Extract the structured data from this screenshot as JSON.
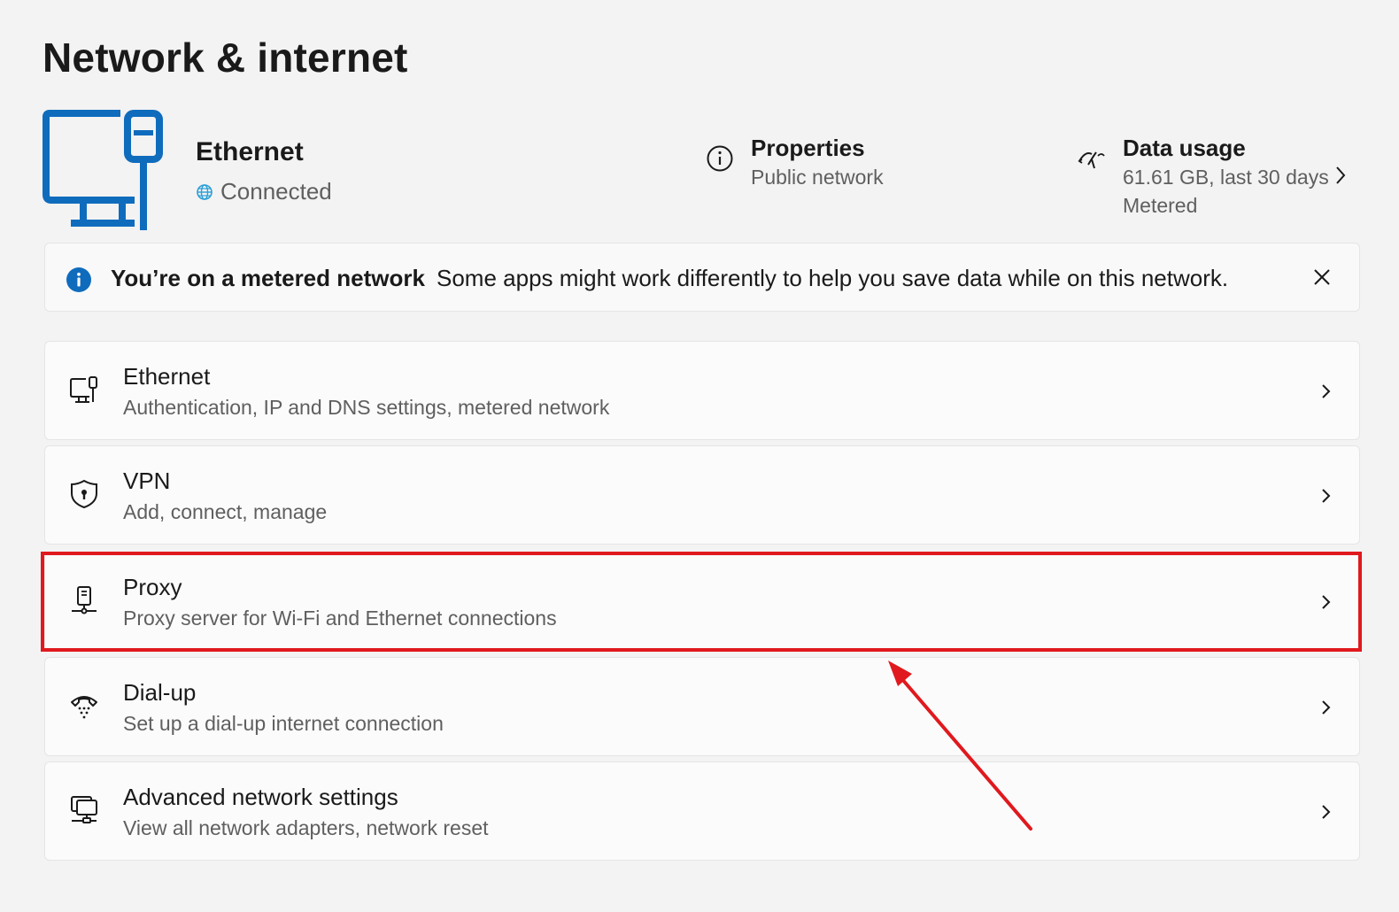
{
  "page": {
    "title": "Network & internet"
  },
  "connection": {
    "name": "Ethernet",
    "status": "Connected",
    "properties": {
      "title": "Properties",
      "subtitle": "Public network"
    },
    "data_usage": {
      "title": "Data usage",
      "line1": "61.61 GB, last 30 days",
      "line2": "Metered"
    }
  },
  "infobar": {
    "title": "You’re on a metered network",
    "message": "Some apps might work differently to help you save data while on this network."
  },
  "cards": [
    {
      "title": "Ethernet",
      "subtitle": "Authentication, IP and DNS settings, metered network",
      "icon": "ethernet-icon"
    },
    {
      "title": "VPN",
      "subtitle": "Add, connect, manage",
      "icon": "shield-icon"
    },
    {
      "title": "Proxy",
      "subtitle": "Proxy server for Wi-Fi and Ethernet connections",
      "icon": "proxy-icon"
    },
    {
      "title": "Dial-up",
      "subtitle": "Set up a dial-up internet connection",
      "icon": "dialup-icon"
    },
    {
      "title": "Advanced network settings",
      "subtitle": "View all network adapters, network reset",
      "icon": "advanced-network-icon"
    }
  ],
  "colors": {
    "accent": "#0f6cbd",
    "annotation": "#e0191e",
    "background": "#f3f3f3",
    "card": "#fbfbfb"
  }
}
